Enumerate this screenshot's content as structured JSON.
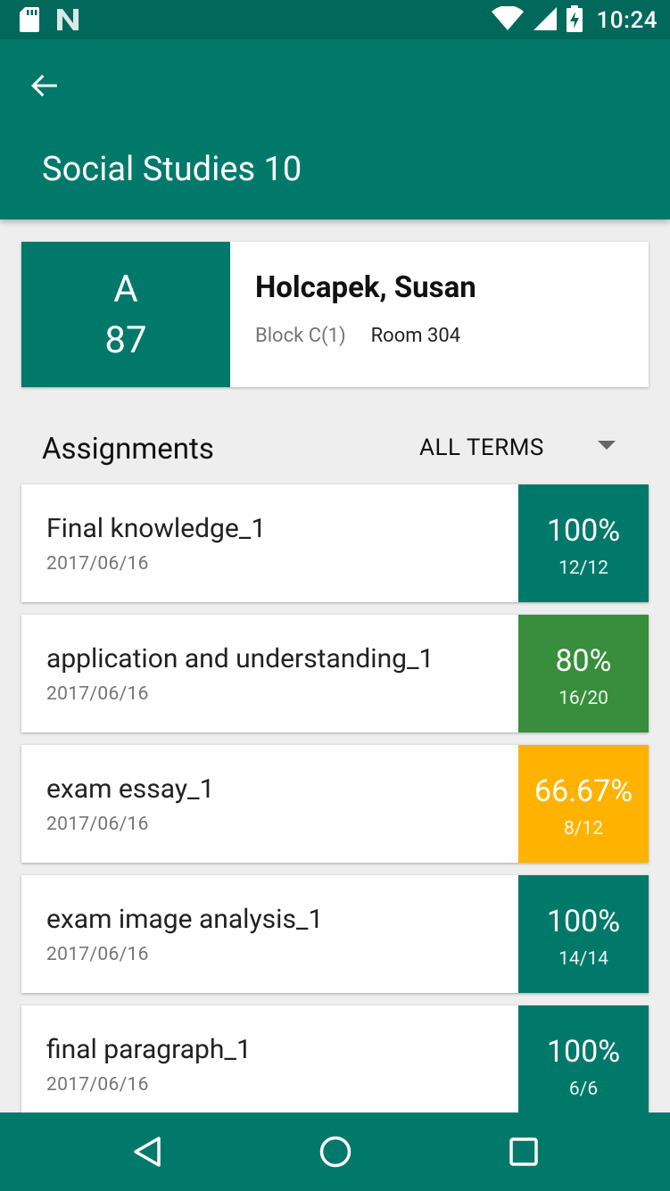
{
  "status_bar": {
    "time": "10:24",
    "icons": [
      "sd-card-icon",
      "notification-n-icon",
      "wifi-icon",
      "cell-signal-icon",
      "battery-charging-icon"
    ]
  },
  "app_bar": {
    "title": "Social Studies 10"
  },
  "teacher_card": {
    "grade_letter": "A",
    "grade_score": "87",
    "teacher_name": "Holcapek, Susan",
    "block": "Block C(1)",
    "room": "Room 304"
  },
  "assignments_section": {
    "heading": "Assignments",
    "filter_label": "ALL TERMS"
  },
  "assignments": [
    {
      "name": "Final knowledge_1",
      "date": "2017/06/16",
      "percent": "100%",
      "fraction": "12/12",
      "color": "#00796b"
    },
    {
      "name": "application and understanding_1",
      "date": "2017/06/16",
      "percent": "80%",
      "fraction": "16/20",
      "color": "#388e3c"
    },
    {
      "name": "exam essay_1",
      "date": "2017/06/16",
      "percent": "66.67%",
      "fraction": "8/12",
      "color": "#ffb300"
    },
    {
      "name": "exam image analysis_1",
      "date": "2017/06/16",
      "percent": "100%",
      "fraction": "14/14",
      "color": "#00796b"
    },
    {
      "name": "final paragraph_1",
      "date": "2017/06/16",
      "percent": "100%",
      "fraction": "6/6",
      "color": "#00796b"
    }
  ],
  "colors": {
    "primary": "#00796b",
    "primary_dark": "#00695c",
    "good": "#388e3c",
    "warning": "#ffb300"
  }
}
